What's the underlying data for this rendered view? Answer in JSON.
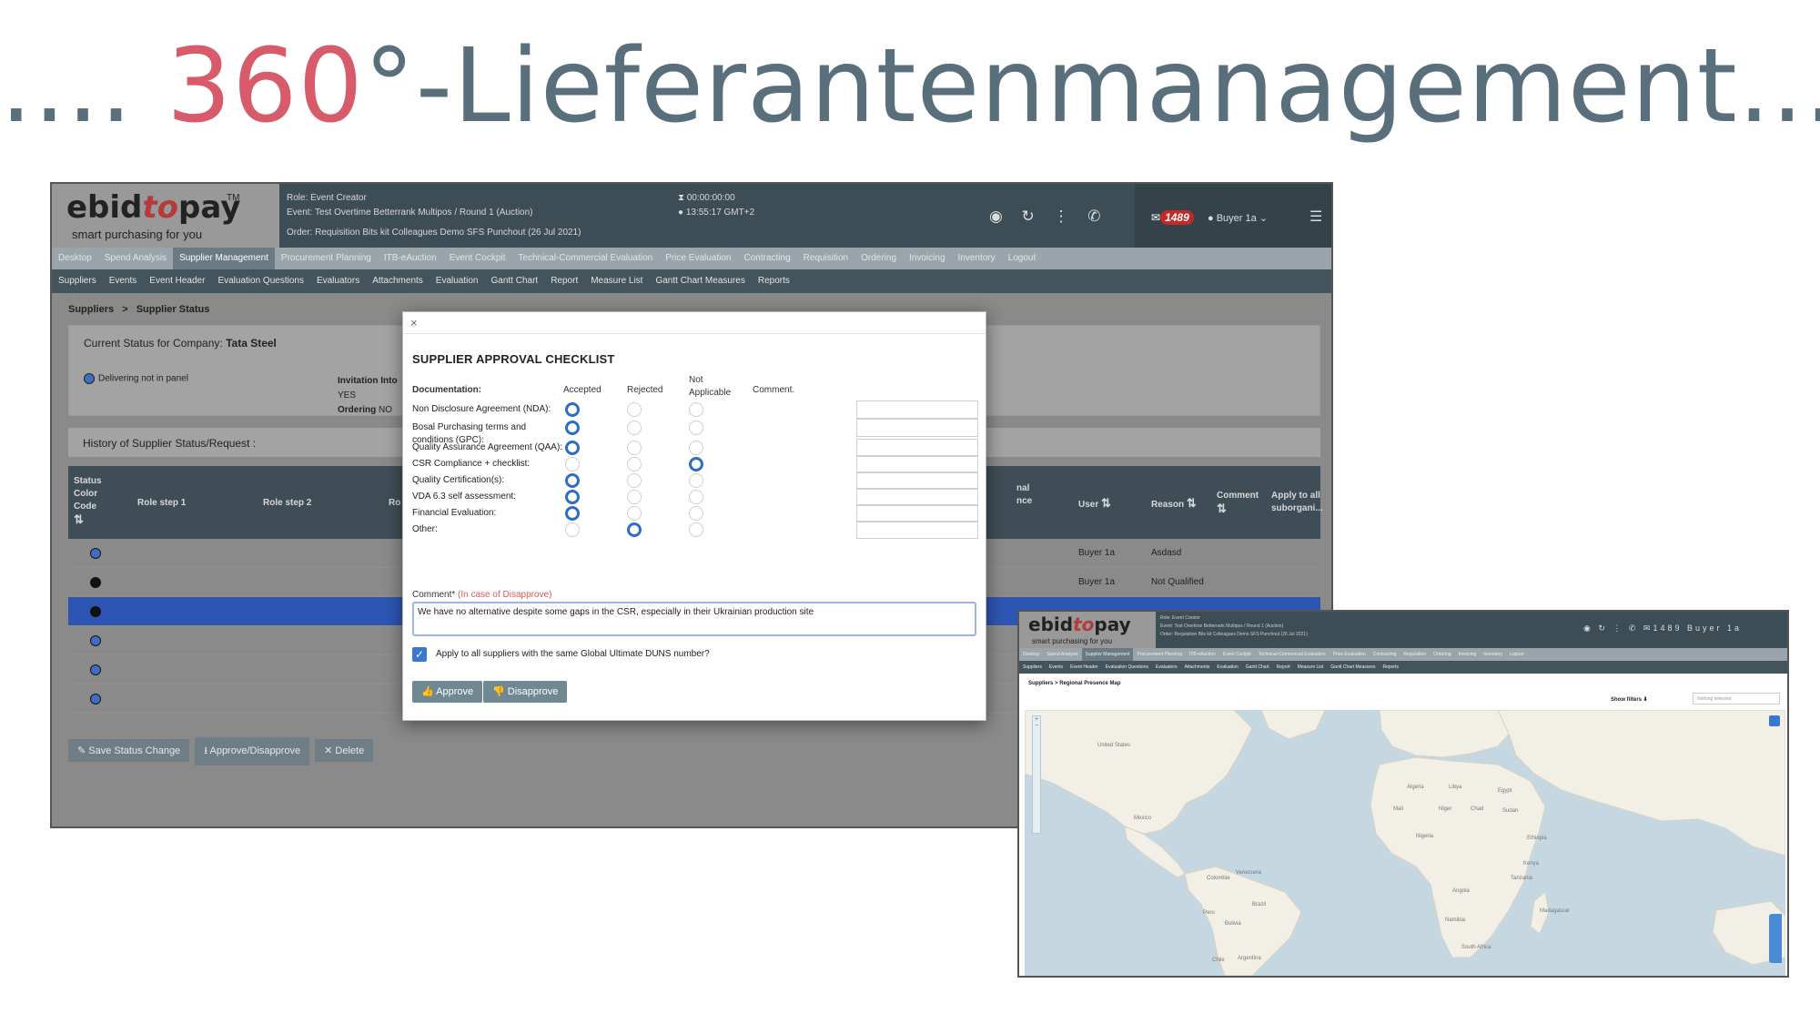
{
  "slide": {
    "title_prefix": ".... ",
    "title_accent": "360",
    "title_suffix": "°-Lieferantenmanagement...."
  },
  "app": {
    "logo_ebid": "ebid",
    "logo_to": "to",
    "logo_pay": "pay",
    "logo_tm": "TM",
    "logo_tagline": "smart purchasing for you",
    "role": "Role:  Event Creator",
    "event": "Event:  Test Overtime Betterrank Multipos / Round 1 (Auction)",
    "order": "Order:  Requisition Bits kit Colleagues Demo SFS Punchout (26 Jul 2021)",
    "timer_top": "00:00:00:00",
    "timer_bottom": "13:55:17 GMT+2",
    "notif_count": "1489",
    "user": "Buyer 1a",
    "icons": "◉ ↻ ⋮ ✆",
    "menu_icon": "☰",
    "colors": {
      "header": "#3d4d55",
      "accent_blue": "#2f6dc7",
      "selected_row": "#2d55b3"
    }
  },
  "nav_main": [
    "Desktop",
    "Spend Analysis",
    "Supplier Management",
    "Procurement Planning",
    "ITB-eAuction",
    "Event Cockpit",
    "Technical-Commercial Evaluation",
    "Price Evaluation",
    "Contracting",
    "Requisition",
    "Ordering",
    "Invoicing",
    "Inventory",
    "Logout"
  ],
  "nav_sub": [
    "Suppliers",
    "Events",
    "Event Header",
    "Evaluation Questions",
    "Evaluators",
    "Attachments",
    "Evaluation",
    "Gantt Chart",
    "Report",
    "Measure List",
    "Gantt Chart Measures",
    "Reports"
  ],
  "breadcrumb": {
    "root": "Suppliers",
    "sep": ">",
    "current": "Supplier Status"
  },
  "status_panel": {
    "label": "Current Status for Company:",
    "company": "Tata Steel",
    "delivering": "Delivering not in panel",
    "invitation_label": "Invitation Into",
    "invitation_value": "YES",
    "ordering_label": "Ordering",
    "ordering_value": "NO"
  },
  "history": {
    "title": "History of Supplier Status/Request :",
    "headers": {
      "status": "Status Color Code",
      "role1": "Role step 1",
      "role2": "Role step 2",
      "role3": "Ro",
      "nal": "nal nce",
      "user": "User",
      "reason": "Reason",
      "comment": "Comment",
      "apply": "Apply to all suborgani..."
    },
    "sort_icon": "⇅",
    "rows": [
      {
        "color": "#3f6fc2",
        "user": "Buyer 1a",
        "reason": "Asdasd"
      },
      {
        "color": "#111111",
        "user": "Buyer 1a",
        "reason": "Not Qualified"
      },
      {
        "color": "#111111",
        "user": "",
        "reason": ""
      },
      {
        "color": "#3f6fc2",
        "user": "",
        "reason": ""
      },
      {
        "color": "#3f6fc2",
        "user": "",
        "reason": ""
      },
      {
        "color": "#3f6fc2",
        "user": "",
        "reason": ""
      }
    ]
  },
  "actions": {
    "save": "✎  Save Status Change",
    "approve": "⭳  Approve/Disapprove",
    "delete": "✕  Delete"
  },
  "modal": {
    "close": "×",
    "title": "SUPPLIER APPROVAL CHECKLIST",
    "col_doc": "Documentation:",
    "col_accepted": "Accepted",
    "col_rejected": "Rejected",
    "col_na": "Not Applicable",
    "col_comment": "Comment.",
    "items": [
      {
        "label": "Non Disclosure Agreement (NDA):",
        "sel": "accepted"
      },
      {
        "label": "Bosal Purchasing terms and conditions (GPC):",
        "sel": "accepted"
      },
      {
        "label": "Quality Assurance Agreement (QAA):",
        "sel": "accepted"
      },
      {
        "label": "CSR Compliance + checklist:",
        "sel": "na"
      },
      {
        "label": "Quality Certification(s):",
        "sel": "accepted"
      },
      {
        "label": "VDA 6.3 self assessment:",
        "sel": "accepted"
      },
      {
        "label": "Financial Evaluation:",
        "sel": "accepted"
      },
      {
        "label": "Other:",
        "sel": "rejected"
      }
    ],
    "comment_label": "Comment*",
    "comment_req": "(In case of Disapprove)",
    "comment_value": "We have no alternative despite some gaps in the CSR, especially in their Ukrainian production site",
    "check_mark": "✓",
    "apply_all": "Apply to all suppliers with the same Global Ultimate DUNS number?",
    "approve": "👍  Approve",
    "disapprove": "👎  Disapprove"
  },
  "map_screen": {
    "breadcrumb_root": "Suppliers",
    "breadcrumb_sep": ">",
    "breadcrumb_current": "Regional Presence Map",
    "show_filters": "Show filters ⬇",
    "select_placeholder": "Nothing selected",
    "zoom_in": "+",
    "zoom_out": "−",
    "icons": "◉ ↻ ⋮ ✆   ✉1489   Buyer 1a",
    "regions": [
      "United States",
      "Mexico",
      "Brazil",
      "Algeria",
      "Libya",
      "Egypt",
      "Mali",
      "Niger",
      "Chad",
      "Sudan",
      "Nigeria",
      "Ethiopia",
      "Kenya",
      "Tanzania",
      "Angola",
      "Namibia",
      "South Africa",
      "Madagascar",
      "Peru",
      "Bolivia",
      "Argentina",
      "Chile",
      "Colombia",
      "Venezuela"
    ]
  }
}
